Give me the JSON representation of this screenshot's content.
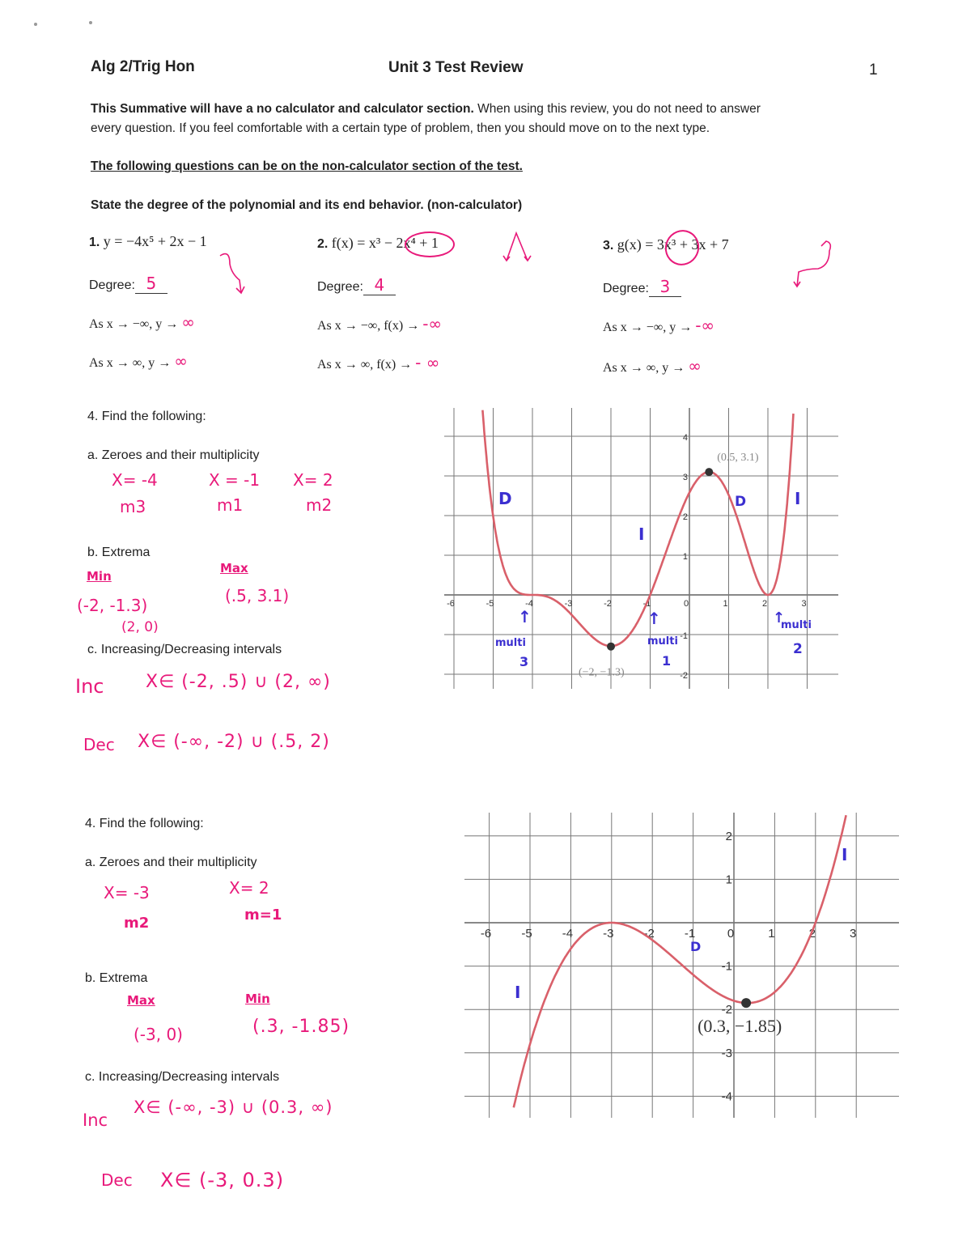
{
  "header": {
    "course": "Alg 2/Trig Hon",
    "title": "Unit 3 Test Review",
    "page_number": "1"
  },
  "intro": {
    "line1_bold": "This Summative will have a no calculator and calculator section.",
    "line1_rest": " When using this review, you do not need to answer",
    "line2": "every question.  If you feel comfortable with a certain type of problem, then you should move on to the next type."
  },
  "section_heading": "The following questions can be on the non-calculator section of the test.",
  "instruction": "State the degree of the polynomial and its end behavior.  (non-calculator)",
  "problems": [
    {
      "num": "1.",
      "expr": "y = −4x⁵ + 2x − 1",
      "degree_label": "Degree:",
      "degree": "5",
      "left_label": "As x → −∞, y →",
      "left_answer": "∞",
      "right_label": "As x → ∞, y →",
      "right_answer": "∞"
    },
    {
      "num": "2.",
      "expr": "f(x) = x³ − 2x⁴ + 1",
      "degree_label": "Degree:",
      "degree": "4",
      "left_label": "As x → −∞, f(x) →",
      "left_answer": "-∞",
      "right_label": "As x → ∞,  f(x) →",
      "right_answer": "- ∞"
    },
    {
      "num": "3.",
      "expr": "g(x) = 3x³ + 3x + 7",
      "degree_label": "Degree:",
      "degree": "3",
      "left_label": "As x → −∞, y →",
      "left_answer": "-∞",
      "right_label": "As x → ∞, y →",
      "right_answer": "∞"
    }
  ],
  "q4a": {
    "title": "4.   Find the following:",
    "zeros_label": "a. Zeroes and their multiplicity",
    "zeros": [
      {
        "x": "X= -4",
        "m": "m3"
      },
      {
        "x": "X = -1",
        "m": "m1"
      },
      {
        "x": "X= 2",
        "m": "m2"
      }
    ],
    "extrema_label": "b.  Extrema",
    "min_label": "Min",
    "min_values": [
      "(-2, -1.3)",
      "(2, 0)"
    ],
    "max_label": "Max",
    "max_values": [
      "(.5, 3.1)"
    ],
    "intervals_label": "c.  Increasing/Decreasing intervals",
    "inc_label": "Inc",
    "inc_value": "X∈ (-2, .5) ∪ (2, ∞)",
    "dec_label": "Dec",
    "dec_value": "X∈ (-∞, -2) ∪ (.5, 2)"
  },
  "q4b": {
    "title": "4.   Find the following:",
    "zeros_label": "a. Zeroes and their multiplicity",
    "zeros": [
      {
        "x": "X= -3",
        "m": "m2"
      },
      {
        "x": "X= 2",
        "m": "m=1"
      }
    ],
    "extrema_label": "b.  Extrema",
    "max_label": "Max",
    "max_values": [
      "(-3, 0)"
    ],
    "min_label": "Min",
    "min_values": [
      "(.3, -1.85)"
    ],
    "intervals_label": "c.  Increasing/Decreasing intervals",
    "inc_label": "Inc",
    "inc_value": "X∈ (-∞, -3) ∪ (0.3, ∞)",
    "dec_label": "Dec",
    "dec_value": "X∈ (-3, 0.3)"
  },
  "graphs": [
    {
      "x_ticks": [
        "-6",
        "-5",
        "-4",
        "-3",
        "-2",
        "-1",
        "0",
        "1",
        "2",
        "3"
      ],
      "y_ticks": [
        "-2",
        "-1",
        "1",
        "2",
        "3",
        "4"
      ],
      "xlim": [
        -6,
        3.6
      ],
      "ylim": [
        -2.3,
        4.7
      ],
      "zeros": [
        {
          "x": -4,
          "multiplicity": 3
        },
        {
          "x": -1,
          "multiplicity": 1
        },
        {
          "x": 2,
          "multiplicity": 2
        }
      ],
      "points": [
        {
          "x": 0.5,
          "y": 3.1,
          "label": "(0.5, 3.1)"
        },
        {
          "x": -2,
          "y": -1.3,
          "label": "(−2, −1.3)"
        }
      ],
      "annotations": {
        "d1": "D",
        "d2": "D",
        "i1": "I",
        "i2": "I",
        "arrow": "↑",
        "multi": "multi",
        "m3": "3",
        "m1": "1",
        "m2": "2"
      },
      "curve_color": "#d9606a"
    },
    {
      "x_ticks": [
        "-6",
        "-5",
        "-4",
        "-3",
        "-2",
        "-1",
        "0",
        "1",
        "2",
        "3"
      ],
      "y_ticks": [
        "-4",
        "-3",
        "-2",
        "-1",
        "1",
        "2"
      ],
      "xlim": [
        -6.5,
        3.3
      ],
      "ylim": [
        -4.3,
        2.5
      ],
      "zeros": [
        {
          "x": -3,
          "multiplicity": 2
        },
        {
          "x": 2,
          "multiplicity": 1
        }
      ],
      "points": [
        {
          "x": 0.3,
          "y": -1.85,
          "label": "(0.3, −1.85)"
        }
      ],
      "annotations": {
        "i1": "I",
        "d1": "D",
        "i2": "I"
      },
      "curve_color": "#d9606a"
    }
  ],
  "colors": {
    "pen_pink": "#e8197a",
    "pen_blue": "#3b2fd0",
    "curve": "#d9606a"
  }
}
